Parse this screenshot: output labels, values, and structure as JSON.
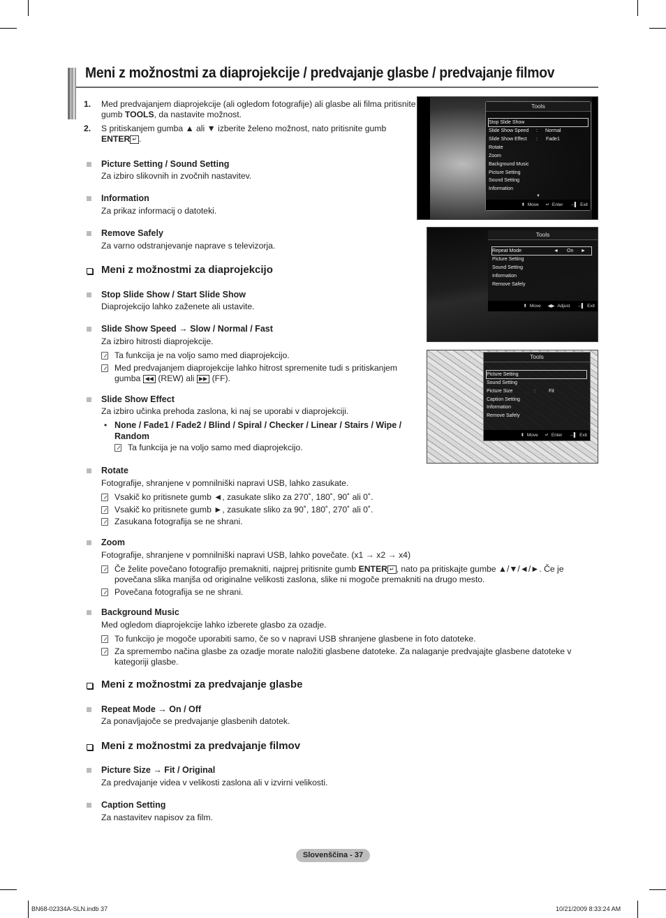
{
  "page": {
    "title": "Meni z možnostmi za diaprojekcije / predvajanje glasbe / predvajanje filmov"
  },
  "steps": [
    {
      "num": "1.",
      "line1": "Med predvajanjem diaprojekcije (ali ogledom fotografije) ali glasbe ali filma pritisnite",
      "line2_pre": "gumb ",
      "line2_bold": "TOOLS",
      "line2_post": ", da nastavite možnost."
    },
    {
      "num": "2.",
      "line1": "S pritiskanjem gumba ▲ ali ▼ izberite želeno možnost, nato pritisnite gumb",
      "line2_bold": "ENTER",
      "line2_post": "."
    }
  ],
  "general_items": [
    {
      "heading": "Picture Setting / Sound Setting",
      "desc": "Za izbiro slikovnih in zvočnih nastavitev."
    },
    {
      "heading": "Information",
      "desc": "Za prikaz informacij o datoteki."
    },
    {
      "heading": "Remove Safely",
      "desc": "Za varno odstranjevanje naprave s televizorja."
    }
  ],
  "slideshow": {
    "section_title": "Meni z možnostmi za diaprojekcijo",
    "items": [
      {
        "heading": "Stop Slide Show / Start Slide Show",
        "desc": "Diaprojekcijo lahko zaženete ali ustavite."
      },
      {
        "heading": "Slide Show Speed → Slow / Normal / Fast",
        "desc": "Za izbiro hitrosti diaprojekcije.",
        "notes": [
          "Ta funkcija je na voljo samo med diaprojekcijo.",
          "Med predvajanjem diaprojekcije lahko hitrost spremenite tudi s pritiskanjem"
        ],
        "note2_line2_pre": "gumba ",
        "note2_rew_icon": "◀◀",
        "note2_rew": " (REW) ali ",
        "note2_ff_icon": "▶▶",
        "note2_ff": " (FF)."
      },
      {
        "heading": "Slide Show Effect",
        "desc": "Za izbiro učinka prehoda zaslona, ki naj se uporabi v diaprojekciji.",
        "bullet_line1": "None / Fade1 / Fade2 / Blind / Spiral / Checker / Linear / Stairs / Wipe /",
        "bullet_line2": "Random",
        "bullet_note": "Ta funkcija je na voljo samo med diaprojekcijo."
      },
      {
        "heading": "Rotate",
        "desc": "Fotografije, shranjene v pomnilniški napravi USB, lahko zasukate.",
        "notes": [
          "Vsakič ko pritisnete gumb ◄, zasukate sliko za 270˚, 180˚, 90˚ ali 0˚.",
          "Vsakič ko pritisnete gumb ►, zasukate sliko za 90˚, 180˚, 270˚ ali 0˚.",
          "Zasukana fotografija se ne shrani."
        ]
      },
      {
        "heading": "Zoom",
        "desc": "Fotografije, shranjene v pomnilniški napravi USB, lahko povečate. (x1 → x2 → x4)",
        "note1_pre": "Če želite povečano fotografijo premakniti, najprej pritisnite gumb ",
        "note1_bold": "ENTER",
        "note1_post": ", nato pa pritiskajte gumbe ▲/▼/◄/►. Če je",
        "note1_line2": "povečana slika manjša od originalne velikosti zaslona, slike ni mogoče premakniti na drugo mesto.",
        "note2": "Povečana fotografija se ne shrani."
      },
      {
        "heading": "Background Music",
        "desc": "Med ogledom diaprojekcije lahko izberete glasbo za ozadje.",
        "notes": [
          "To funkcijo je mogoče uporabiti samo, če so v napravi USB shranjene glasbene in foto datoteke.",
          "Za spremembo načina glasbe za ozadje morate naložiti glasbene datoteke. Za nalaganje predvajajte glasbene datoteke v"
        ],
        "note2_line2": "kategoriji glasbe."
      }
    ]
  },
  "music": {
    "section_title": "Meni z možnostmi za predvajanje glasbe",
    "items": [
      {
        "heading": "Repeat Mode → On / Off",
        "desc": "Za ponavljajoče se predvajanje glasbenih datotek."
      }
    ]
  },
  "movie": {
    "section_title": "Meni z možnostmi za predvajanje filmov",
    "items": [
      {
        "heading": "Picture Size → Fit / Original",
        "desc": "Za predvajanje videa v velikosti zaslona ali v izvirni velikosti."
      },
      {
        "heading": "Caption Setting",
        "desc": "Za nastavitev napisov za film."
      }
    ]
  },
  "screens": [
    {
      "title": "Tools",
      "items": [
        {
          "label": "Stop Slide Show",
          "value": "",
          "selected": true
        },
        {
          "label": "Slide Show Speed",
          "value": "Normal"
        },
        {
          "label": "Slide Show Effect",
          "value": "Fade1"
        },
        {
          "label": "Rotate",
          "value": ""
        },
        {
          "label": "Zoom",
          "value": ""
        },
        {
          "label": "Background Music",
          "value": ""
        },
        {
          "label": "Picture Setting",
          "value": ""
        },
        {
          "label": "Sound Setting",
          "value": ""
        },
        {
          "label": "Information",
          "value": ""
        }
      ],
      "more_icon": "▼",
      "footer": {
        "move": "Move",
        "enter": "Enter",
        "exit": "Exit"
      }
    },
    {
      "title": "Tools",
      "items": [
        {
          "label": "Repeat Mode",
          "value": "On",
          "selected": true
        },
        {
          "label": "Picture Setting"
        },
        {
          "label": "Sound Setting"
        },
        {
          "label": "Information"
        },
        {
          "label": "Remove Safely"
        }
      ],
      "footer": {
        "move": "Move",
        "adjust": "Adjust",
        "exit": "Exit"
      }
    },
    {
      "title": "Tools",
      "items": [
        {
          "label": "Picture Setting",
          "selected": true
        },
        {
          "label": "Sound Setting"
        },
        {
          "label": "Picture Size",
          "value": "Fit"
        },
        {
          "label": "Caption Setting"
        },
        {
          "label": "Information"
        },
        {
          "label": "Remove Safely"
        }
      ],
      "footer": {
        "move": "Move",
        "enter": "Enter",
        "exit": "Exit"
      }
    }
  ],
  "icons": {
    "move": "⬍",
    "enter": "↵",
    "exit": "→▌",
    "adjust": "◀▶",
    "left": "◄",
    "right": "►",
    "colon": ":"
  },
  "footer": {
    "page_label": "Slovenščina - 37",
    "file": "BN68-02334A-SLN.indb   37",
    "timestamp": "10/21/2009   8:33:24 AM"
  }
}
